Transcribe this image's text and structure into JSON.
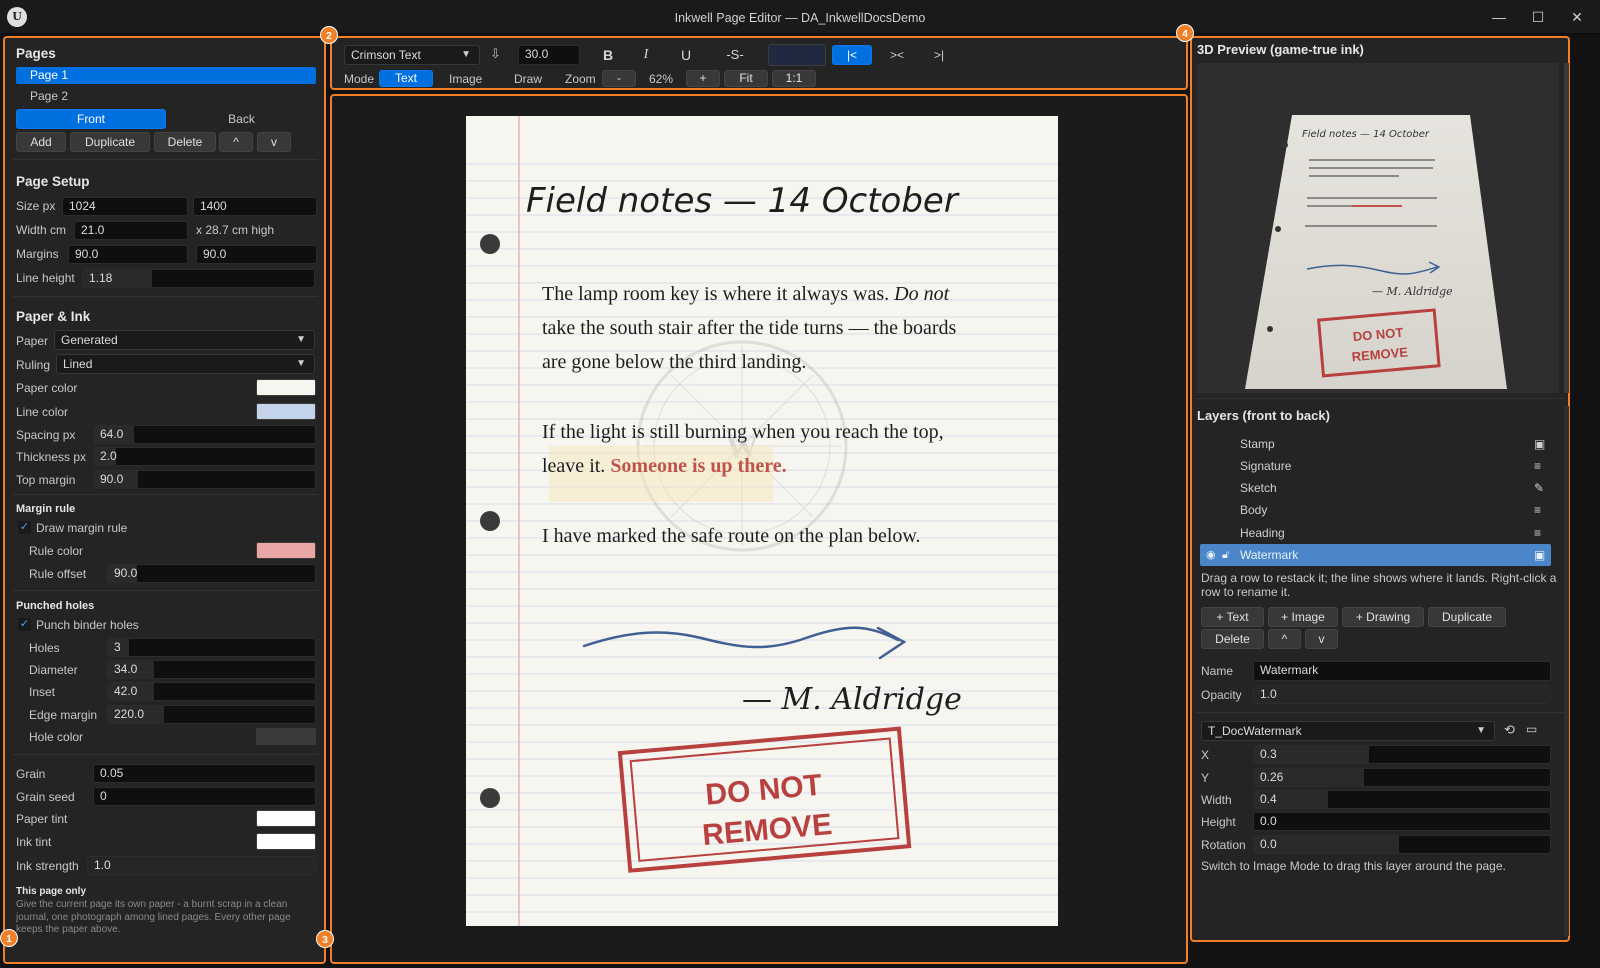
{
  "window": {
    "title": "Inkwell Page Editor — DA_InkwellDocsDemo",
    "logo": "U",
    "minimize": "—",
    "maximize": "☐",
    "close": "✕"
  },
  "badges": [
    "1",
    "2",
    "3",
    "4"
  ],
  "left": {
    "pages_title": "Pages",
    "pages": [
      "Page 1",
      "Page 2"
    ],
    "front": "Front",
    "back": "Back",
    "buttons": {
      "add": "Add",
      "duplicate": "Duplicate",
      "delete": "Delete",
      "up": "^",
      "down": "v"
    },
    "setup_title": "Page Setup",
    "size_label": "Size px",
    "size_w": "1024",
    "size_h": "1400",
    "width_label": "Width cm",
    "width_val": "21.0",
    "width_note": "x 28.7 cm high",
    "margins_label": "Margins",
    "margin_a": "90.0",
    "margin_b": "90.0",
    "line_height_label": "Line height",
    "line_height": "1.18",
    "paper_ink_title": "Paper & Ink",
    "paper_label": "Paper",
    "paper_val": "Generated",
    "ruling_label": "Ruling",
    "ruling_val": "Lined",
    "paper_color_label": "Paper color",
    "line_color_label": "Line color",
    "spacing_label": "Spacing px",
    "spacing": "64.0",
    "thickness_label": "Thickness px",
    "thickness": "2.0",
    "top_margin_label": "Top margin",
    "top_margin": "90.0",
    "margin_rule_title": "Margin rule",
    "draw_margin_rule": "Draw margin rule",
    "rule_color_label": "Rule color",
    "rule_offset_label": "Rule offset",
    "rule_offset": "90.0",
    "punched_title": "Punched holes",
    "punch_label": "Punch binder holes",
    "holes_label": "Holes",
    "holes": "3",
    "diameter_label": "Diameter",
    "diameter": "34.0",
    "inset_label": "Inset",
    "inset": "42.0",
    "edge_margin_label": "Edge margin",
    "edge_margin": "220.0",
    "hole_color_label": "Hole color",
    "grain_label": "Grain",
    "grain": "0.05",
    "grain_seed_label": "Grain seed",
    "grain_seed": "0",
    "paper_tint_label": "Paper tint",
    "ink_tint_label": "Ink tint",
    "ink_strength_label": "Ink strength",
    "ink_strength": "1.0",
    "page_only_title": "This page only",
    "page_only_text": "Give the current page its own paper - a burnt scrap in a clean journal, one photograph among lined pages. Every other page keeps the paper above.",
    "colors": {
      "paper": "#f7f5ef",
      "line": "#c3d3ea",
      "rule": "#e8a6a6",
      "hole": "#3a3a3a",
      "paper_tint": "#ffffff",
      "ink_tint": "#ffffff"
    }
  },
  "toolbar": {
    "font": "Crimson Text",
    "size": "30.0",
    "bold": "B",
    "italic": "I",
    "underline": "U",
    "strike": "-S-",
    "align_left": "|<",
    "align_center": "><",
    "align_right": ">|",
    "mode_label": "Mode",
    "modes": [
      "Text",
      "Image",
      "Draw"
    ],
    "zoom_label": "Zoom",
    "zoom_minus": "-",
    "zoom_value": "62%",
    "zoom_plus": "+",
    "fit": "Fit",
    "one_to_one": "1:1",
    "color_swatch": "#1f2a40"
  },
  "page": {
    "heading": "Field notes — 14 October",
    "p1a": "The lamp room key is where it always was. ",
    "p1_italic": "Do not",
    "p1b": " take the south stair after the tide turns — the boards are gone below the third landing.",
    "p2a": "If the light is still burning when you reach the top, leave it. ",
    "p2_red": "Someone is up there.",
    "p3": "I have marked the safe route on the plan below.",
    "signature": "— M. Aldridge",
    "stamp_line1": "DO NOT",
    "stamp_line2": "REMOVE",
    "watermark": "W",
    "colors": {
      "paper": "#f7f5ef",
      "line": "#d6e0ef",
      "margin": "#eab3b3",
      "ink": "#1e1e1e",
      "red": "#c0544a",
      "stamp": "#b8413f",
      "arrow": "#3f5f95"
    }
  },
  "preview": {
    "title": "3D Preview (game-true ink)"
  },
  "layers": {
    "title": "Layers (front to back)",
    "items": [
      {
        "name": "Stamp",
        "icon": "image-icon"
      },
      {
        "name": "Signature",
        "icon": "text-icon"
      },
      {
        "name": "Sketch",
        "icon": "pencil-icon"
      },
      {
        "name": "Body",
        "icon": "text-icon"
      },
      {
        "name": "Heading",
        "icon": "text-icon"
      },
      {
        "name": "Watermark",
        "icon": "image-icon"
      }
    ],
    "hint": "Drag a row to restack it; the line shows where it lands. Right-click a row to rename it.",
    "buttons": {
      "text": "+ Text",
      "image": "+ Image",
      "drawing": "+ Drawing",
      "duplicate": "Duplicate",
      "delete": "Delete",
      "up": "^",
      "down": "v"
    },
    "name_label": "Name",
    "name_val": "Watermark",
    "opacity_label": "Opacity",
    "opacity": "1.0",
    "texture": "T_DocWatermark",
    "x_label": "X",
    "x": "0.3",
    "y_label": "Y",
    "y": "0.26",
    "width_label": "Width",
    "width": "0.4",
    "height_label": "Height",
    "height": "0.0",
    "rotation_label": "Rotation",
    "rotation": "0.0",
    "footer": "Switch to Image Mode to drag this layer around the page."
  }
}
